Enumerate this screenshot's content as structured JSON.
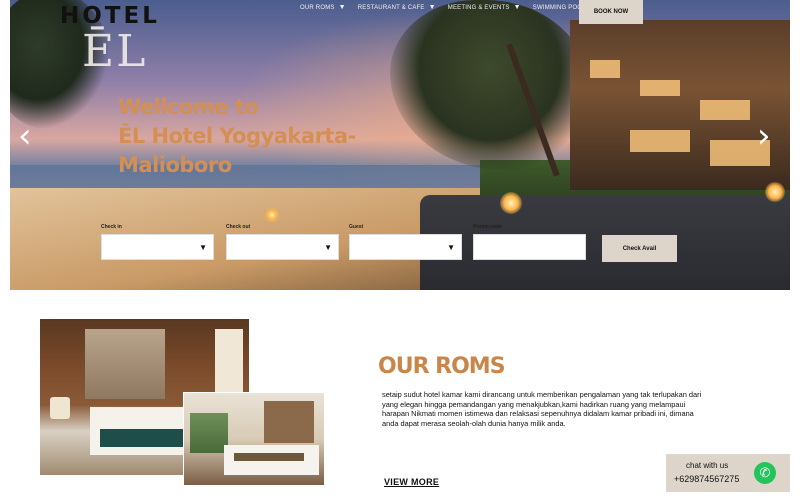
{
  "brand": {
    "line1": "HOTEL",
    "line2": "ĒL"
  },
  "nav": {
    "items": [
      {
        "label": "OUR ROMS"
      },
      {
        "label": "RESTAURANT & CAFE"
      },
      {
        "label": "MEETING & EVENTS"
      },
      {
        "label": "SWIMMING POOL"
      }
    ],
    "book_label": "BOOK NOW"
  },
  "hero": {
    "welcome_lines": [
      "Wellcome to",
      "ĒL Hotel  Yogyakarta-",
      "Malioboro"
    ],
    "prev_arrow": "‹",
    "next_arrow": "›",
    "icons": {
      "prev": "chevron-left-icon",
      "next": "chevron-right-icon",
      "dropdown": "caret-down-icon"
    }
  },
  "booking": {
    "check_in_label": "Check in",
    "check_out_label": "Check out",
    "guest_label": "Guest",
    "promo_label": "Promo code",
    "check_in_value": "",
    "check_out_value": "",
    "guest_value": "",
    "promo_value": "",
    "submit_label": "Check Avail"
  },
  "rooms": {
    "title": "OUR ROMS",
    "description": "setaip sudut hotel kamar kami dirancang untuk memberikan pengalaman yang tak terlupakan  dari yang elegan hingga pemandangan yang menakjubkan,kami hadirkan ruang yang melampaui harapan Nikmati momen istimewa dan relaksasi sepenuhnya didalam kamar pribadi ini, dimana anda dapat merasa seolah-olah dunia hanya milik anda.",
    "view_more": "VIEW MORE"
  },
  "chat": {
    "label": "chat with us",
    "phone": "+629874567275",
    "icon": "phone-icon"
  },
  "colors": {
    "accent": "#c9864b",
    "button_bg": "#ded5ca",
    "whatsapp": "#25c35b"
  }
}
